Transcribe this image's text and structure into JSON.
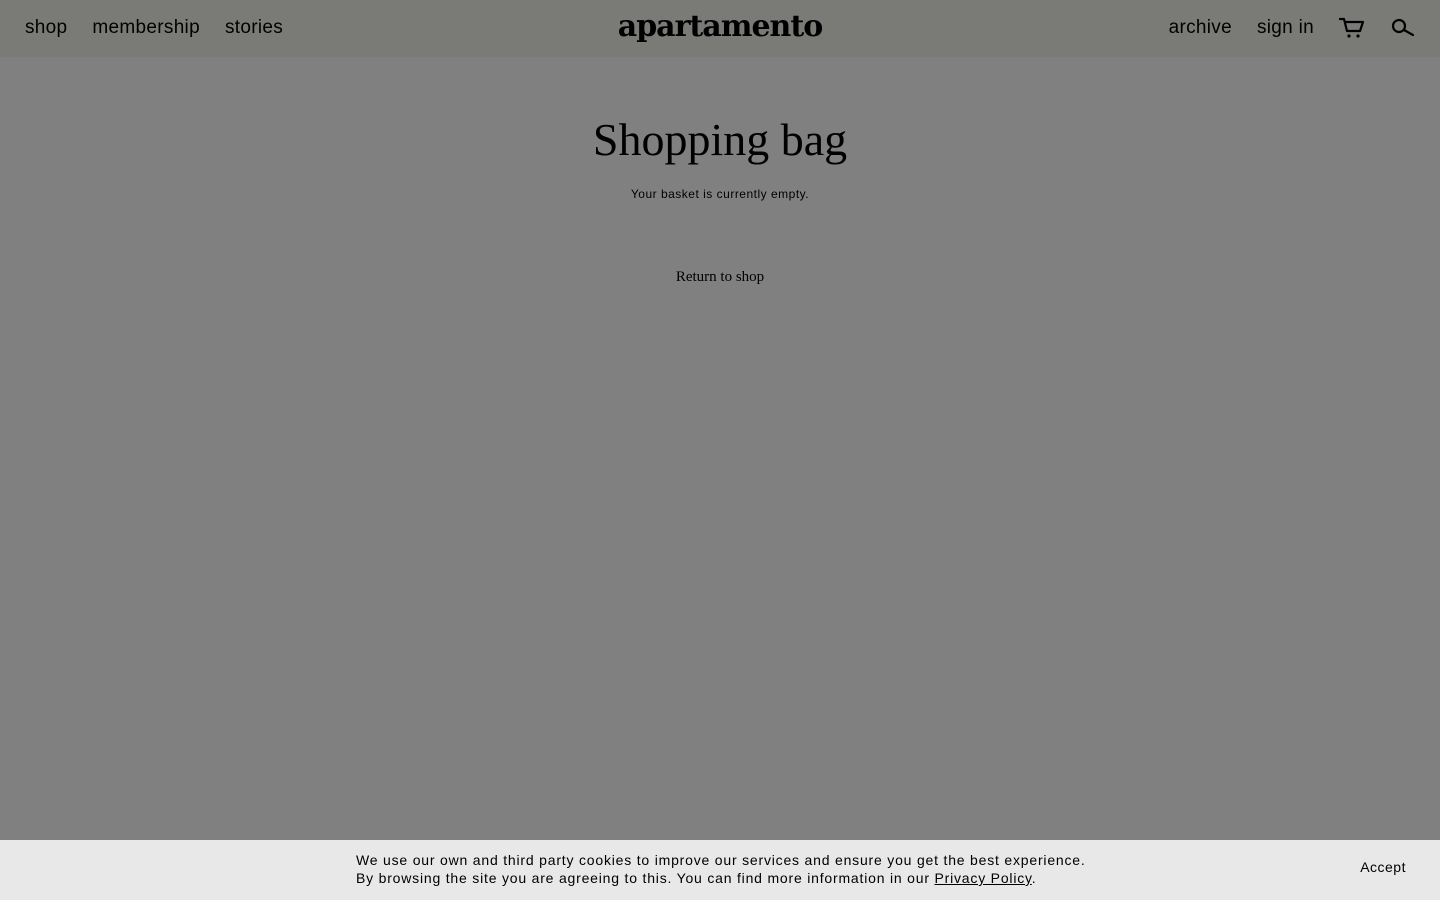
{
  "header": {
    "logo": "apartamento",
    "nav_left": [
      {
        "label": "shop"
      },
      {
        "label": "membership"
      },
      {
        "label": "stories"
      }
    ],
    "nav_right": {
      "archive": "archive",
      "sign_in": "sign in",
      "cart_icon": "cart-icon",
      "search_icon": "search-icon"
    }
  },
  "main": {
    "title": "Shopping bag",
    "empty_message": "Your basket is currently empty.",
    "return_link": "Return to shop"
  },
  "cookie": {
    "line1": "We use our own and third party cookies to improve our services and ensure you get the best experience.",
    "line2_prefix": "By browsing the site you are agreeing to this. You can find more information in our ",
    "link": "Privacy Policy",
    "line2_suffix": ".",
    "accept": "Accept"
  },
  "colors": {
    "overlay_bg": "#808080",
    "header_bg": "#7a7a77",
    "cookie_bg": "#e8e8e8"
  }
}
